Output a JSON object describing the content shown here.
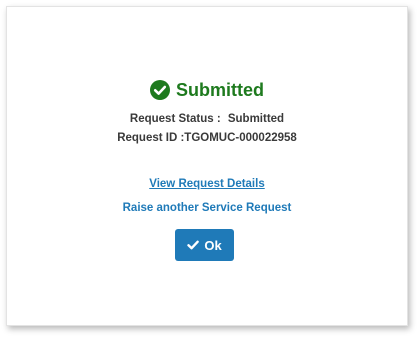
{
  "dialog": {
    "title": "Submitted",
    "title_icon": "check-circle-icon",
    "success_color": "#1e7a1e",
    "status_label": "Request Status :",
    "status_value": "Submitted",
    "request_id_label": "Request ID :",
    "request_id_value": "TGOMUC-000022958",
    "view_details_link": "View Request Details",
    "raise_request_link": "Raise another Service Request",
    "ok_label": "Ok",
    "ok_icon": "checkmark-icon",
    "accent_color": "#1f7ab8"
  }
}
